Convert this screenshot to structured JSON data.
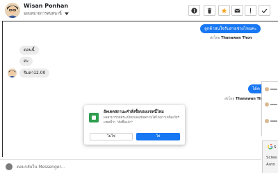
{
  "header": {
    "contact_name": "Wisan Ponhan",
    "contact_sub": "มอบหมายการสนทนานี้",
    "buttons": [
      {
        "name": "info-button",
        "icon": "info-icon"
      },
      {
        "name": "delete-button",
        "icon": "trash-icon"
      },
      {
        "name": "star-button",
        "icon": "star-icon",
        "color": "#f5a623"
      },
      {
        "name": "mail-button",
        "icon": "mail-icon"
      },
      {
        "name": "flag-button",
        "icon": "exclamation-icon"
      },
      {
        "name": "done-button",
        "icon": "check-icon"
      }
    ]
  },
  "conversation": {
    "messages": [
      {
        "direction": "out",
        "text": "ลูกค้าสนใจรับสายช่วงไหนคะ"
      },
      {
        "direction": "in",
        "text": "ตอนนี้"
      },
      {
        "direction": "in",
        "text": "ค่ะ"
      },
      {
        "direction": "in",
        "text": "ริมลา12.00"
      },
      {
        "direction": "out",
        "text": "ได้ค"
      }
    ],
    "sent_by_prefix": "ส่งโดย",
    "sent_by_name": "Thanawan Thon"
  },
  "dialog": {
    "title": "อัพเดตสถานะคำสั่งซื้อของแชทนี้ไหม",
    "body": "ผลสามารถจัดระเบียบกล่องข้อความได้ไหมว่าเหนือเกียร์แชทนี้ว่า \"สั่งซื้อแล้ว\"",
    "no_label": "ไม่ใช่",
    "yes_label": "ใช่"
  },
  "composer": {
    "placeholder": "ตอบกลับใน Messenger..."
  },
  "side_card": {
    "line1": "S",
    "line2": "Scree",
    "line3": "Auto"
  },
  "colors": {
    "accent": "#1877f2",
    "star": "#f5a623",
    "dialog_icon": "#2e9e4e"
  }
}
